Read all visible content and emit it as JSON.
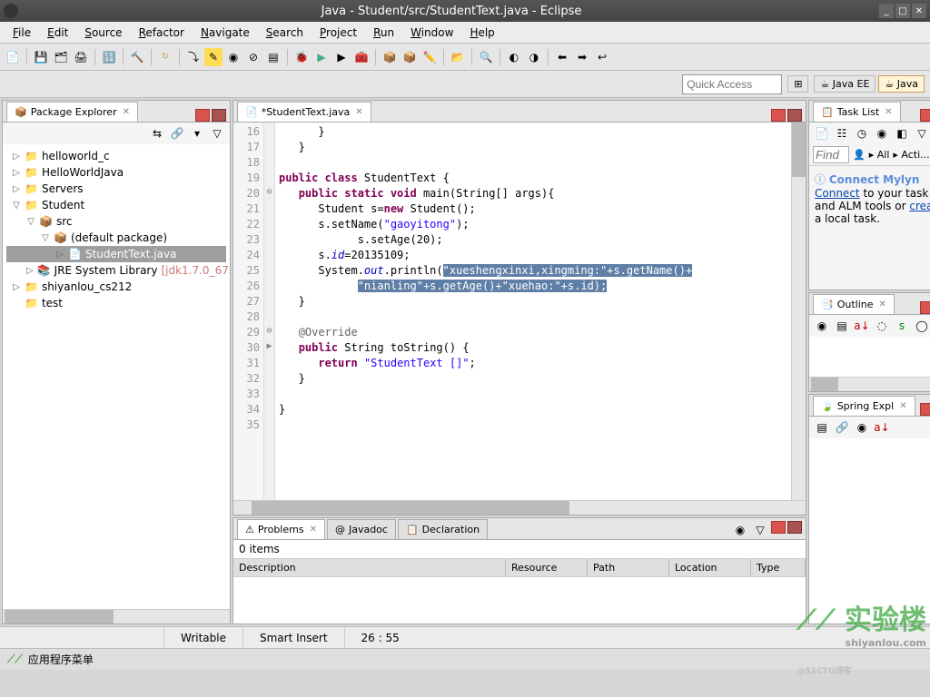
{
  "window": {
    "title": "Java - Student/src/StudentText.java - Eclipse"
  },
  "menus": [
    "File",
    "Edit",
    "Source",
    "Refactor",
    "Navigate",
    "Search",
    "Project",
    "Run",
    "Window",
    "Help"
  ],
  "quick_access": {
    "placeholder": "Quick Access"
  },
  "perspectives": [
    {
      "label": "Java EE",
      "active": false
    },
    {
      "label": "Java",
      "active": true
    }
  ],
  "package_explorer": {
    "title": "Package Explorer",
    "items": [
      {
        "indent": 0,
        "tw": "▷",
        "icon": "📁",
        "label": "helloworld_c"
      },
      {
        "indent": 0,
        "tw": "▷",
        "icon": "📁",
        "label": "HelloWorldJava"
      },
      {
        "indent": 0,
        "tw": "▷",
        "icon": "📁",
        "label": "Servers"
      },
      {
        "indent": 0,
        "tw": "▽",
        "icon": "📁",
        "label": "Student"
      },
      {
        "indent": 1,
        "tw": "▽",
        "icon": "📦",
        "label": "src"
      },
      {
        "indent": 2,
        "tw": "▽",
        "icon": "📦",
        "label": "(default package)"
      },
      {
        "indent": 3,
        "tw": "▷",
        "icon": "📄",
        "label": "StudentText.java",
        "selected": true
      },
      {
        "indent": 1,
        "tw": "▷",
        "icon": "📚",
        "label": "JRE System Library ",
        "suffix": "[jdk1.7.0_67"
      },
      {
        "indent": 0,
        "tw": "▷",
        "icon": "📁",
        "label": "shiyanlou_cs212"
      },
      {
        "indent": 0,
        "tw": "",
        "icon": "📁",
        "label": "test"
      }
    ]
  },
  "editor": {
    "tab_label": "*StudentText.java",
    "first_line_no": 16,
    "lines": [
      {
        "n": 16,
        "seg": [
          {
            "t": "      }"
          }
        ]
      },
      {
        "n": 17,
        "seg": [
          {
            "t": "   }"
          }
        ]
      },
      {
        "n": 18,
        "seg": [
          {
            "t": ""
          }
        ]
      },
      {
        "n": 19,
        "seg": [
          {
            "c": "kw",
            "t": "public class"
          },
          {
            "t": " StudentText {"
          }
        ]
      },
      {
        "n": 20,
        "fold": "⊖",
        "seg": [
          {
            "t": "   "
          },
          {
            "c": "kw",
            "t": "public static void"
          },
          {
            "t": " main(String[] "
          },
          {
            "c": "",
            "t": "args"
          },
          {
            "t": "){"
          }
        ]
      },
      {
        "n": 21,
        "seg": [
          {
            "t": "      Student s="
          },
          {
            "c": "kw",
            "t": "new"
          },
          {
            "t": " Student();"
          }
        ]
      },
      {
        "n": 22,
        "seg": [
          {
            "t": "      s.setName("
          },
          {
            "c": "str",
            "t": "\"gaoyitong\""
          },
          {
            "t": ");"
          }
        ]
      },
      {
        "n": 23,
        "seg": [
          {
            "t": "            s.setAge(20);"
          }
        ]
      },
      {
        "n": 24,
        "seg": [
          {
            "t": "      s."
          },
          {
            "c": "fld",
            "t": "id"
          },
          {
            "t": "=20135109;"
          }
        ]
      },
      {
        "n": 25,
        "seg": [
          {
            "t": "      System."
          },
          {
            "c": "fld",
            "t": "out"
          },
          {
            "t": ".println("
          },
          {
            "c": "sel",
            "t": "\"xueshengxinxi,xingming:\"+s.getName()+"
          }
        ]
      },
      {
        "n": 26,
        "seg": [
          {
            "t": "            "
          },
          {
            "c": "sel",
            "t": "\"nianling\"+s.getAge()+\"xuehao:\"+s.id);"
          }
        ]
      },
      {
        "n": 27,
        "seg": [
          {
            "t": "   }"
          }
        ]
      },
      {
        "n": 28,
        "seg": [
          {
            "t": ""
          }
        ]
      },
      {
        "n": 29,
        "fold": "⊖",
        "seg": [
          {
            "t": "   "
          },
          {
            "c": "ann",
            "t": "@Override"
          }
        ]
      },
      {
        "n": 30,
        "mark": "▶",
        "seg": [
          {
            "t": "   "
          },
          {
            "c": "kw",
            "t": "public"
          },
          {
            "t": " String toString() {"
          }
        ]
      },
      {
        "n": 31,
        "seg": [
          {
            "t": "      "
          },
          {
            "c": "kw",
            "t": "return"
          },
          {
            "t": " "
          },
          {
            "c": "str",
            "t": "\"StudentText []\""
          },
          {
            "t": ";"
          }
        ]
      },
      {
        "n": 32,
        "seg": [
          {
            "t": "   }"
          }
        ]
      },
      {
        "n": 33,
        "seg": [
          {
            "t": ""
          }
        ]
      },
      {
        "n": 34,
        "seg": [
          {
            "t": "}"
          }
        ]
      },
      {
        "n": 35,
        "seg": [
          {
            "t": ""
          }
        ]
      }
    ]
  },
  "problems": {
    "tabs": [
      "Problems",
      "Javadoc",
      "Declaration"
    ],
    "items_count": "0 items",
    "columns": [
      "Description",
      "Resource",
      "Path",
      "Location",
      "Type"
    ]
  },
  "right": {
    "task_list": {
      "title": "Task List",
      "find": "Find",
      "filters": [
        "All",
        "Acti..."
      ]
    },
    "mylyn": {
      "title": "Connect Mylyn",
      "text_pre": "Connect",
      "text_mid": " to your task and ALM tools or ",
      "text_link": "create",
      "text_post": " a local task."
    },
    "outline": {
      "title": "Outline"
    },
    "spring": {
      "title": "Spring Expl"
    }
  },
  "status": {
    "mode": "Writable",
    "insert": "Smart Insert",
    "cursor": "26 : 55"
  },
  "taskbar": {
    "label": "应用程序菜单"
  },
  "watermark": {
    "main": "实验楼",
    "sub": "shiyanlou.com",
    "extra": "@51CTO博客"
  }
}
